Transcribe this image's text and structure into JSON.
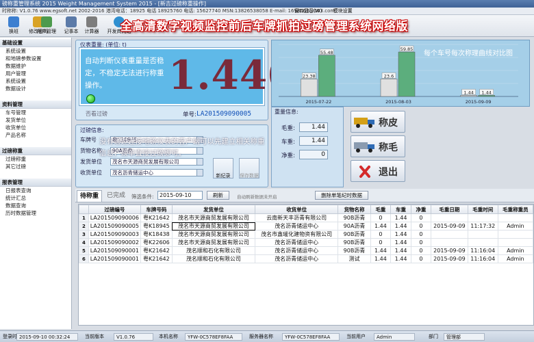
{
  "window": {
    "title": "磅称重管理系统 2015 Weight Management System 2015 - [新吉过磅称重操作]",
    "info_line": "时称称: V1.0.76  www.egsoft.net 2002-2016 港湾电话：18925 电话 18925760  电话: 15627740 MSN:13826538058  E-mail: 1698668@163.com",
    "menus": [
      "窗口显示(W)",
      "模块设置"
    ]
  },
  "toolbar": [
    {
      "label": "换班",
      "color": "#3d7fd0"
    },
    {
      "label": "修改密码",
      "color": "#d9a326"
    },
    {
      "label": "用户管理",
      "color": "#4d9a4d"
    },
    {
      "label": "记事本",
      "color": "#5b7aa8"
    },
    {
      "label": "计算器",
      "color": "#7d7d7d"
    },
    {
      "label": "开发商网站",
      "color": "#2f8fd0"
    }
  ],
  "banner": "全高清数字视频监控前后车牌抓拍过磅管理系统网络版",
  "sidebar": [
    {
      "head": "基础设置",
      "items": [
        "系统设置",
        "和地磅参数设置",
        "数据维护",
        "用户管理",
        "系统设置",
        "数据设计"
      ]
    },
    {
      "head": "资料管理",
      "items": [
        "车号管理",
        "发货单位",
        "收货单位",
        "产品名称"
      ]
    },
    {
      "head": "过磅称重",
      "items": [
        "过磅称重",
        "其它过磅"
      ]
    },
    {
      "head": "报表管理",
      "items": [
        "日报表查询",
        "统计汇总",
        "数据查询",
        "历时数据管理"
      ]
    }
  ],
  "weight": {
    "caption": "仪表重量: (单位: t)",
    "value": "1.440",
    "note": "自动判断仪表重量是否稳定，不稳定无法进行称重操作。",
    "mode_label": "否看过磅",
    "order_label": "单号:",
    "order_no": "LA201509090005"
  },
  "chart_data": {
    "type": "bar",
    "categories": [
      "2015-07-22",
      "2015-08-03",
      "2015-09-09"
    ],
    "series": [
      {
        "color": "#e0e0e0",
        "values": [
          23.38,
          23.6,
          1.44
        ]
      },
      {
        "color": "#5cae7d",
        "values": [
          55.48,
          59.85,
          1.44
        ]
      }
    ],
    "data_labels": [
      [
        "23.38",
        "55.48"
      ],
      [
        "23.6",
        "59.85"
      ],
      [
        "1.44",
        "1.44"
      ]
    ],
    "ylim": [
      0,
      70
    ],
    "grid": true,
    "note": "每个车号每次称理曲线对比图"
  },
  "pass": {
    "caption": "过磅信息:",
    "note": "没有通过连接地磅仪表的客户端可以先建立相关称重信息，磅单直接过磅即可。",
    "fields": [
      {
        "label": "车牌号",
        "value": "粤K18945"
      },
      {
        "label": "货物名称",
        "value": "90A沥青"
      },
      {
        "label": "发货单位",
        "value": "茂名市天源商贸发展有限公司"
      },
      {
        "label": "收货单位",
        "value": "茂名沥青储运中心"
      }
    ],
    "btn_new": "新纪录",
    "btn_save": "保存数据"
  },
  "weigh_info": {
    "caption": "重量信息:",
    "rows": [
      {
        "label": "毛重:",
        "value": "1.44"
      },
      {
        "label": "车重:",
        "value": "1.44"
      },
      {
        "label": "净重:",
        "value": "0"
      }
    ]
  },
  "actions": {
    "tare": "称皮",
    "gross": "称毛",
    "exit": "退出"
  },
  "tabs": {
    "pending": "待称重",
    "done": "已完成"
  },
  "filter": {
    "label": "筛选条件:",
    "date": "2015-09-10",
    "refresh": "刷新",
    "hint": "自动刷新数据未开启",
    "delete": "删除单笔纪时数据"
  },
  "table": {
    "columns": [
      "",
      "过磅编号",
      "车牌号码",
      "发货单位",
      "收货单位",
      "货物名称",
      "毛重",
      "车重",
      "净重",
      "毛重日期",
      "毛重时间",
      "毛重称重员"
    ],
    "rows": [
      [
        "1",
        "LA201509090006",
        "粤K21642",
        "茂名市天源商贸发展有限公司",
        "云南新天丰沥青有限公司",
        "90B沥青",
        "0",
        "1.44",
        "0",
        "",
        "",
        ""
      ],
      [
        "2",
        "LA201509090005",
        "粤K18945",
        "茂名市天源商贸发展有限公司",
        "茂名沥青储运中心",
        "90A沥青",
        "1.44",
        "1.44",
        "0",
        "2015-09-09",
        "11:17:32",
        "Admin"
      ],
      [
        "3",
        "LA201509090003",
        "粤K18438",
        "茂名市天源商贸发展有限公司",
        "茂名市鑫璀化建物资有限公司",
        "90B沥青",
        "0",
        "1.44",
        "0",
        "",
        "",
        ""
      ],
      [
        "4",
        "LA201509090002",
        "粤K22606",
        "茂名市天源商贸发展有限公司",
        "茂名沥青储运中心",
        "90B沥青",
        "0",
        "1.44",
        "0",
        "",
        "",
        ""
      ],
      [
        "5",
        "LA201509090001",
        "粤K21642",
        "茂名顺和石化有限公司",
        "茂名沥青储运中心",
        "90B沥青",
        "1.44",
        "1.44",
        "0",
        "2015-09-09",
        "11:16:04",
        "Admin"
      ],
      [
        "6",
        "LA201509090001",
        "粤K21642",
        "茂名顺和石化有限公司",
        "茂名沥青储运中心",
        "测试",
        "1.44",
        "1.44",
        "0",
        "2015-09-09",
        "11:16:04",
        "Admin"
      ]
    ]
  },
  "status": {
    "datetime_label": "登录时间",
    "datetime": "2015-09-10 00:32:24",
    "version_label": "当前版本",
    "version": "V1.0.76",
    "host_label": "本机名称",
    "host": "YFW-0C578EF8FAA",
    "server_label": "服务器名称",
    "server": "YFW-0C578EF8FAA",
    "user_label": "当前用户",
    "user": "Admin",
    "dept_label": "部门",
    "dept": "管理部"
  }
}
